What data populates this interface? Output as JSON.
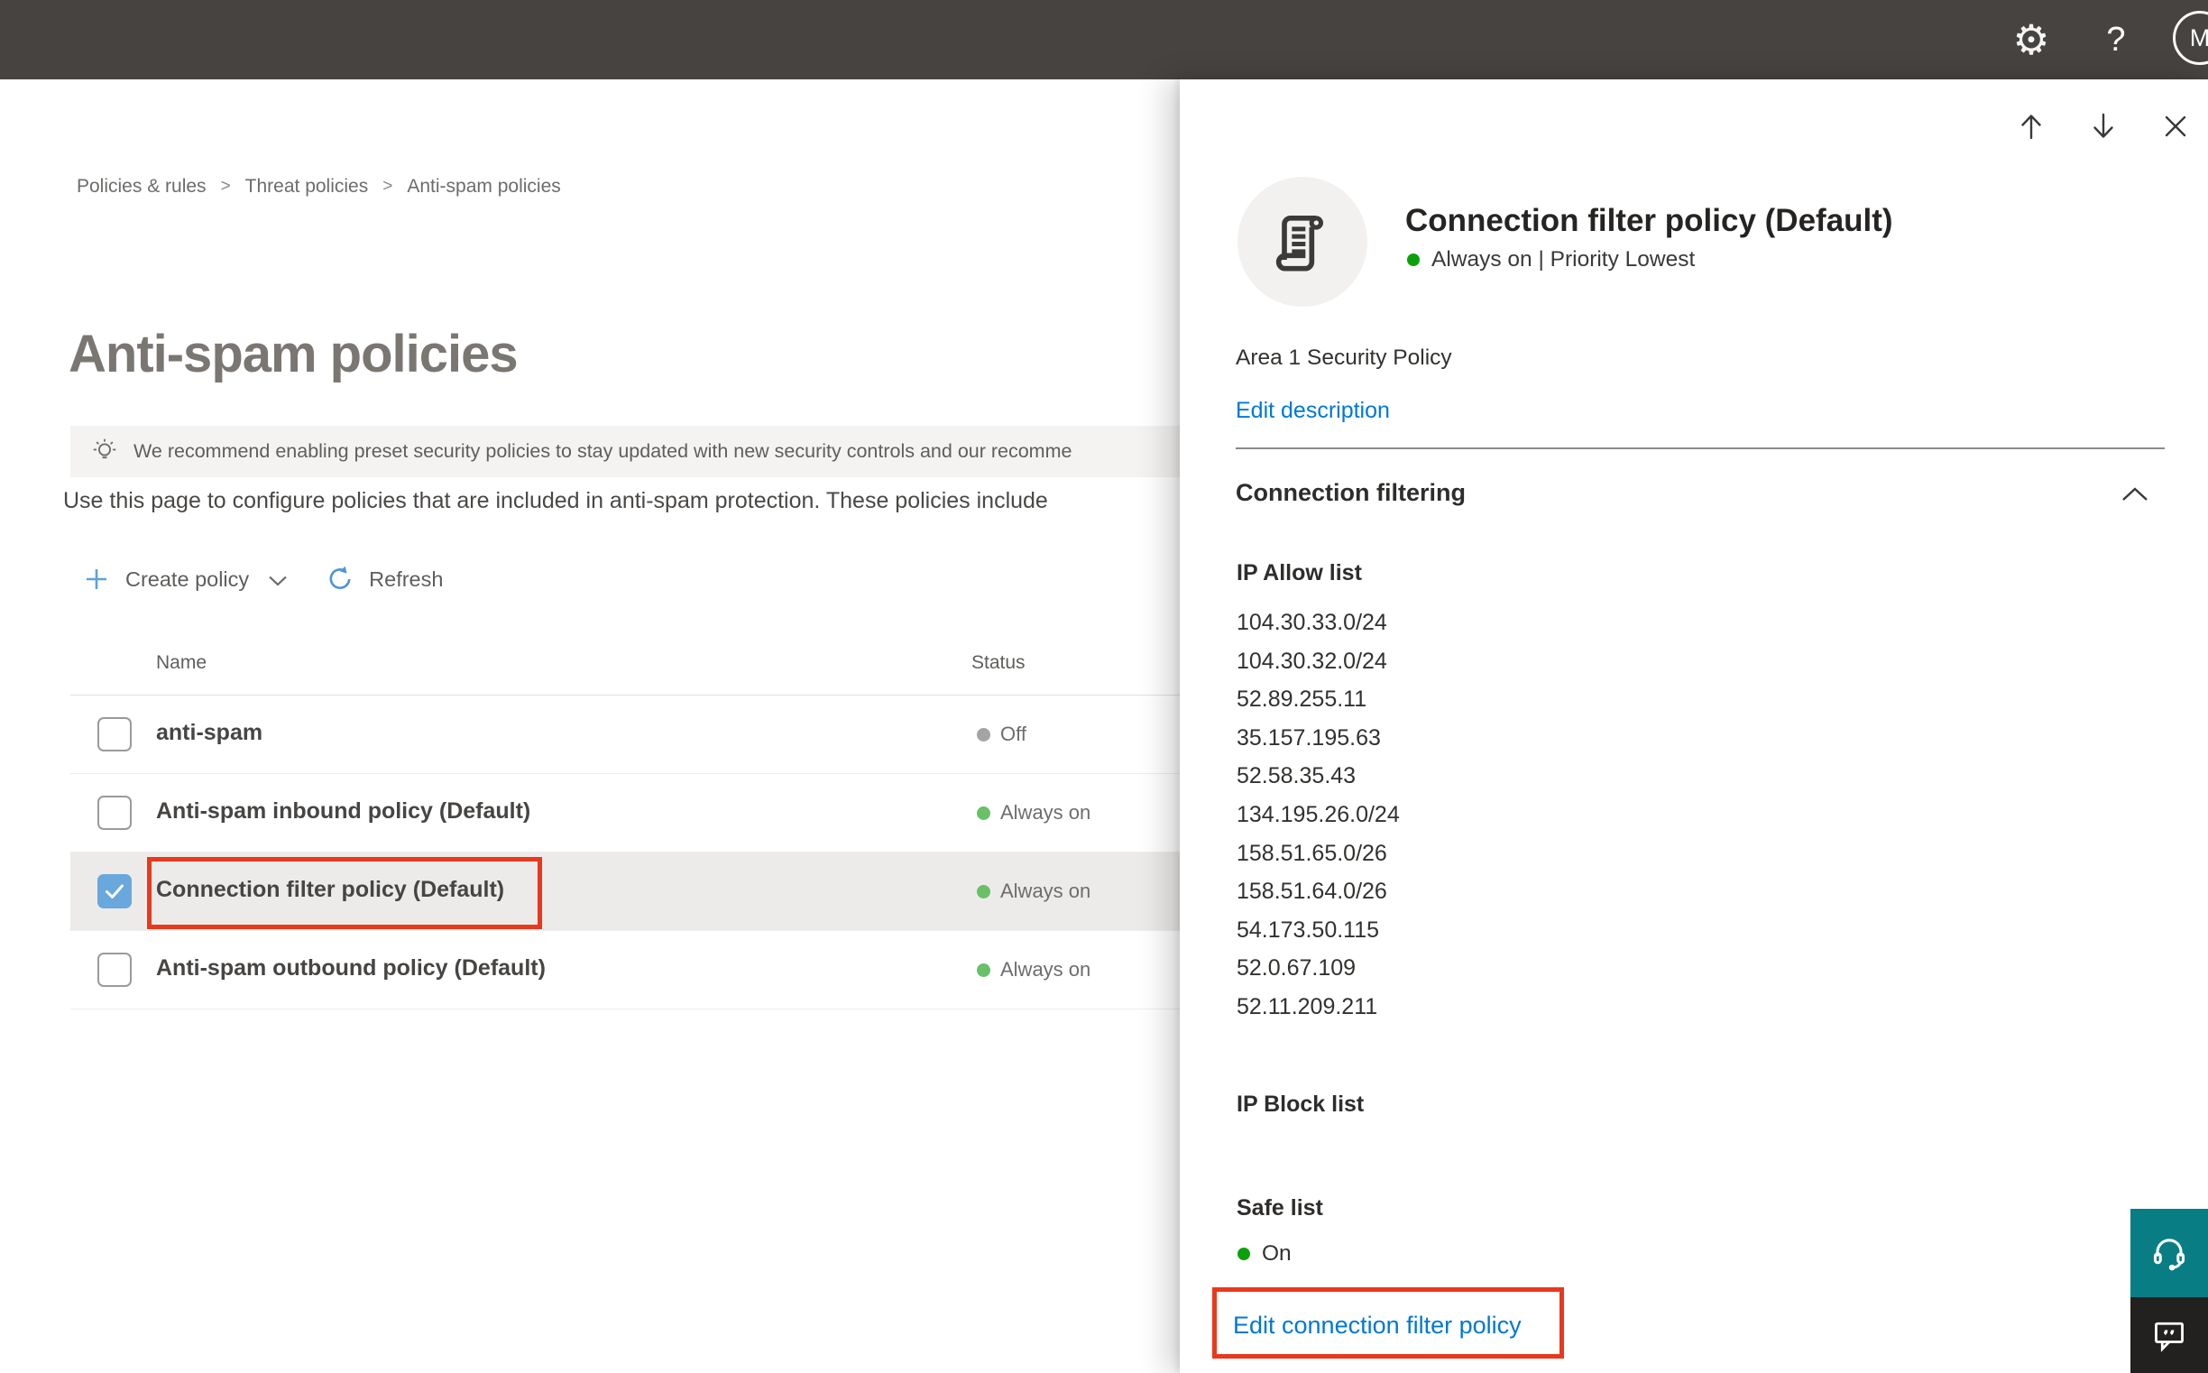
{
  "topbar": {
    "avatar_initial": "M",
    "settings_glyph": "⚙",
    "help_glyph": "?"
  },
  "breadcrumb": {
    "separator": ">",
    "items": [
      "Policies & rules",
      "Threat policies",
      "Anti-spam policies"
    ]
  },
  "main": {
    "title": "Anti-spam policies",
    "banner": "We recommend enabling preset security policies to stay updated with new security controls and our recomme",
    "intro": "Use this page to configure policies that are included in anti-spam protection. These policies include",
    "toolbar": {
      "create": "Create policy",
      "refresh": "Refresh"
    },
    "table": {
      "columns": {
        "name": "Name",
        "status": "Status"
      },
      "rows": [
        {
          "name": "anti-spam",
          "status": "Off"
        },
        {
          "name": "Anti-spam inbound policy (Default)",
          "status": "Always on"
        },
        {
          "name": "Connection filter policy (Default)",
          "status": "Always on"
        },
        {
          "name": "Anti-spam outbound policy (Default)",
          "status": "Always on"
        }
      ]
    }
  },
  "flyout": {
    "title": "Connection filter policy (Default)",
    "status": "Always on | Priority Lowest",
    "description": "Area 1 Security Policy",
    "edit_description": "Edit description",
    "section": "Connection filtering",
    "ip_allow_title": "IP Allow list",
    "ip_allow": [
      "104.30.33.0/24",
      "104.30.32.0/24",
      "52.89.255.11",
      "35.157.195.63",
      "52.58.35.43",
      "134.195.26.0/24",
      "158.51.65.0/26",
      "158.51.64.0/26",
      "54.173.50.115",
      "52.0.67.109",
      "52.11.209.211"
    ],
    "ip_block_title": "IP Block list",
    "safe_list_title": "Safe list",
    "safe_list_status": "On",
    "edit_link": "Edit connection filter policy"
  },
  "colors": {
    "accent_blue": "#0078d4",
    "status_green": "#6abf69",
    "flyout_green": "#0ca10c",
    "status_off_gray": "#a6a4a2",
    "highlight_red": "#e8391d",
    "checkbox_blue": "#68a8dc",
    "teal_button": "#087e84",
    "topbar": "#464341"
  }
}
